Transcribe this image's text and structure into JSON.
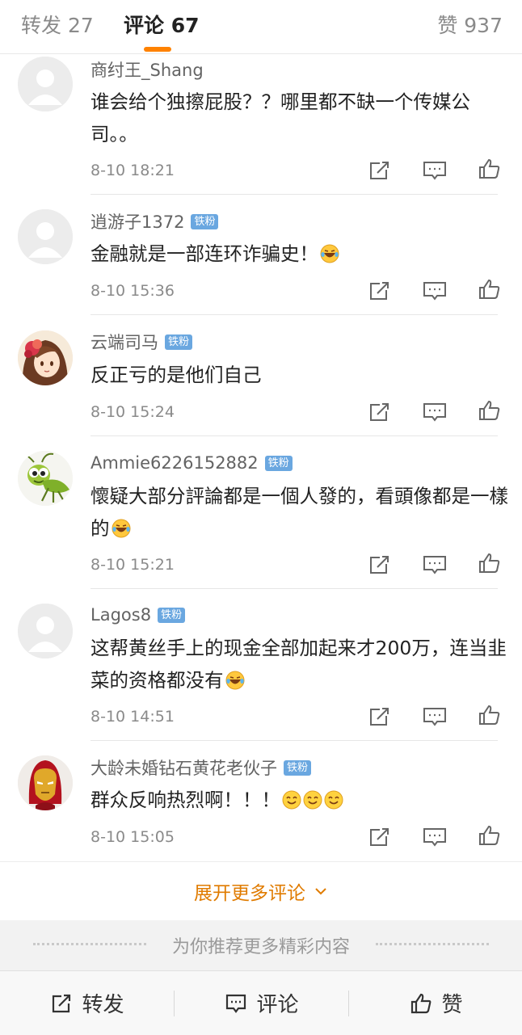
{
  "tabs": {
    "repost": "转发 27",
    "comments": "评论 67",
    "likes": "赞 937"
  },
  "comments": [
    {
      "user": "商纣王_Shang",
      "badge": "",
      "text": "谁会给个独擦屁股？？哪里都不缺一个传媒公司。。",
      "emoji": [],
      "time": "8-10 18:21",
      "avatar": "default"
    },
    {
      "user": "逍游子1372",
      "badge": "铁粉",
      "text": "金融就是一部连环诈骗史！",
      "emoji": [
        "laugh-cry-emoji"
      ],
      "time": "8-10 15:36",
      "avatar": "default"
    },
    {
      "user": "云端司马",
      "badge": "铁粉",
      "text": "反正亏的是他们自己",
      "emoji": [],
      "time": "8-10 15:24",
      "avatar": "anime-girl"
    },
    {
      "user": "Ammie6226152882",
      "badge": "铁粉",
      "text": "懷疑大部分評論都是一個人發的，看頭像都是一樣的",
      "emoji": [
        "laugh-cry-emoji"
      ],
      "time": "8-10 15:21",
      "avatar": "grasshopper"
    },
    {
      "user": "Lagos8",
      "badge": "铁粉",
      "text": "这帮黄丝手上的现金全部加起来才200万，连当韭菜的资格都没有",
      "emoji": [
        "laugh-cry-emoji"
      ],
      "time": "8-10 14:51",
      "avatar": "default"
    },
    {
      "user": "大龄未婚钻石黄花老伙子",
      "badge": "铁粉",
      "text": "群众反响热烈啊！！！",
      "emoji": [
        "smile-emoji",
        "smile-emoji",
        "smile-emoji"
      ],
      "time": "8-10 15:05",
      "avatar": "iron-man"
    }
  ],
  "more_comments": "展开更多评论",
  "recommend": "为你推荐更多精彩内容",
  "bottom": {
    "repost": "转发",
    "comment": "评论",
    "like": "赞"
  },
  "colors": {
    "accent": "#ff8200",
    "more_link": "#e07b00",
    "badge": "#6aa7e0",
    "username": "#636363",
    "meta": "#8a8a8a"
  }
}
